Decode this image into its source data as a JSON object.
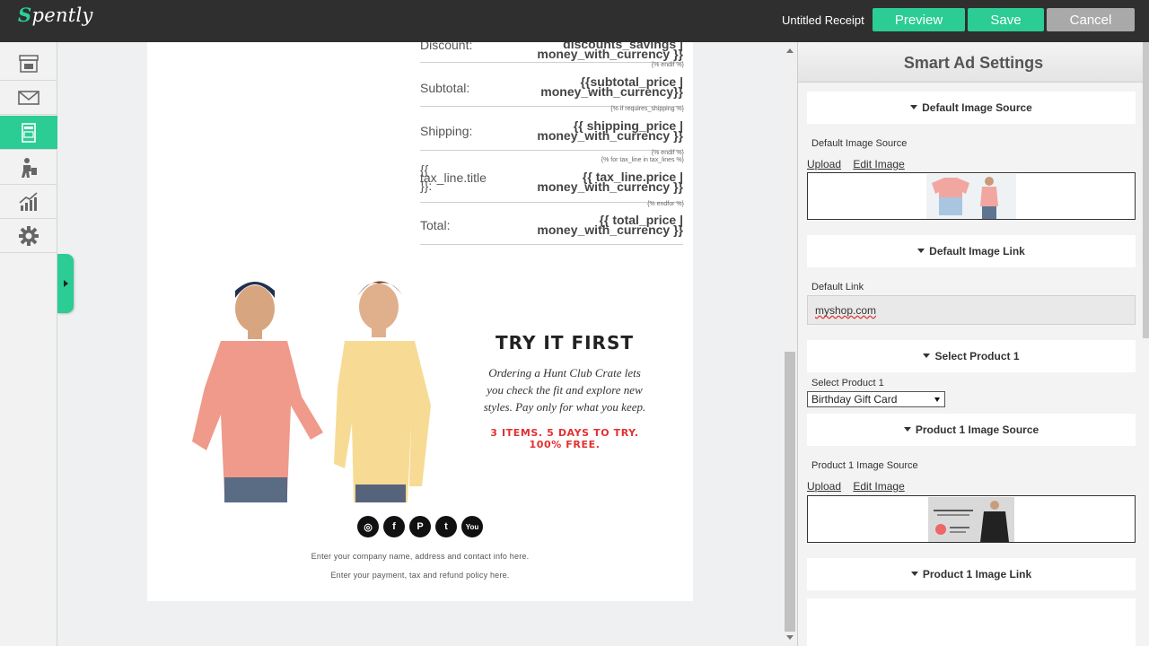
{
  "app": {
    "logo": "Spently",
    "document_title": "Untitled Receipt"
  },
  "toolbar": {
    "preview": "Preview",
    "save": "Save",
    "cancel": "Cancel"
  },
  "sidebar": {
    "items": [
      {
        "icon": "store-icon",
        "active": false
      },
      {
        "icon": "mail-icon",
        "active": false
      },
      {
        "icon": "receipt-template-icon",
        "active": true
      },
      {
        "icon": "shopper-icon",
        "active": false
      },
      {
        "icon": "analytics-icon",
        "active": false
      },
      {
        "icon": "gear-icon",
        "active": false
      }
    ]
  },
  "receipt": {
    "discount": {
      "label": "Discount:",
      "value": "discounts_savings | money_with_currency }}"
    },
    "endif1": "{% endif %}",
    "subtotal": {
      "label": "Subtotal:",
      "value": "{{subtotal_price | money_with_currency}}"
    },
    "if_shipping": "{% if requires_shipping %}",
    "shipping": {
      "label": "Shipping:",
      "value": "{{ shipping_price | money_with_currency }}"
    },
    "endif2": "{% endif %}",
    "for_tax": "{% for tax_line in tax_lines %}",
    "tax": {
      "label": "{{ tax_line.title }}:",
      "value": "{{ tax_line.price | money_with_currency }}"
    },
    "endfor": "{% endfor %}",
    "total": {
      "label": "Total:",
      "value": "{{ total_price | money_with_currency }}"
    }
  },
  "ad": {
    "headline": "TRY IT FIRST",
    "body": "Ordering a Hunt Club Crate lets you check the fit and explore new styles. Pay only for what you keep.",
    "tagline": "3 ITEMS. 5 DAYS TO TRY. 100% FREE."
  },
  "social": [
    {
      "icon": "instagram-icon",
      "glyph": "◎"
    },
    {
      "icon": "facebook-icon",
      "glyph": "f"
    },
    {
      "icon": "pinterest-icon",
      "glyph": "P"
    },
    {
      "icon": "twitter-icon",
      "glyph": "t"
    },
    {
      "icon": "youtube-icon",
      "glyph": "You"
    }
  ],
  "footer": {
    "company": "Enter your company name, address and contact info here.",
    "policy": "Enter your payment, tax and refund policy here."
  },
  "panel": {
    "title": "Smart Ad Settings",
    "sections": {
      "default_image_source": "Default Image Source",
      "default_image_label": "Default Image Source",
      "upload": "Upload",
      "edit_image": "Edit Image",
      "default_image_link": "Default Image Link",
      "default_link_label": "Default Link",
      "default_link_value": "myshop.com",
      "select_product_1": "Select Product 1",
      "select_product_1_label": "Select Product 1",
      "select_product_1_value": "Birthday Gift Card",
      "product1_image_source": "Product 1 Image Source",
      "product1_image_label": "Product 1 Image Source",
      "upload2": "Upload",
      "edit_image2": "Edit Image",
      "product1_image_link": "Product 1 Image Link"
    }
  },
  "colors": {
    "accent": "#2ccc95",
    "topbar": "#2f2f2f",
    "cancel": "#a9a9a9",
    "tagline": "#e33030"
  }
}
